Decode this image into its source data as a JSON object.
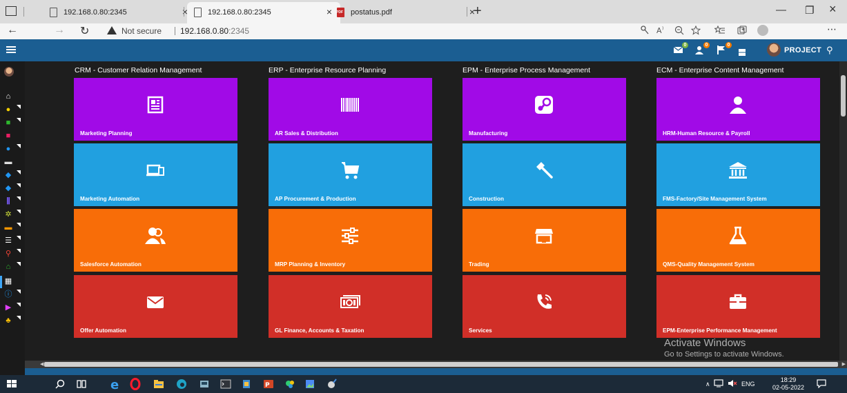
{
  "browser": {
    "tabs": [
      {
        "title": "192.168.0.80:2345",
        "active": false,
        "type": "page"
      },
      {
        "title": "192.168.0.80:2345",
        "active": true,
        "type": "page"
      },
      {
        "title": "postatus.pdf",
        "active": false,
        "type": "pdf"
      }
    ],
    "new_tab_label": "+",
    "close_glyph": "×",
    "security_label": "Not secure",
    "url_host": "192.168.0.80",
    "url_port": ":2345",
    "window_controls": {
      "minimize": "—",
      "restore": "❐",
      "close": "×"
    }
  },
  "header": {
    "project_label": "PROJECT",
    "badges": [
      {
        "icon": "mail-icon",
        "count": "0",
        "color": "#7cb342"
      },
      {
        "icon": "user-alert-icon",
        "count": "0",
        "color": "#f57c00"
      },
      {
        "icon": "flag-icon",
        "count": "0",
        "color": "#f57c00"
      }
    ],
    "accent_color": "#1b5e92"
  },
  "columns": [
    {
      "heading": "CRM - Customer Relation Management",
      "tiles": [
        {
          "label": "Marketing Planning",
          "icon": "newspaper-icon",
          "color": "#a10ae7"
        },
        {
          "label": "Marketing Automation",
          "icon": "devices-icon",
          "color": "#21a0e0"
        },
        {
          "label": "Salesforce Automation",
          "icon": "users-icon",
          "color": "#f86d08"
        },
        {
          "label": "Offer Automation",
          "icon": "envelope-icon",
          "color": "#d12f28"
        }
      ]
    },
    {
      "heading": "ERP - Enterprise Resource Planning",
      "tiles": [
        {
          "label": "AR Sales & Distribution",
          "icon": "barcode-icon",
          "color": "#a10ae7"
        },
        {
          "label": "AP Procurement & Production",
          "icon": "cart-icon",
          "color": "#21a0e0"
        },
        {
          "label": "MRP Planning & Inventory",
          "icon": "sliders-icon",
          "color": "#f86d08"
        },
        {
          "label": "GL Finance, Accounts & Taxation",
          "icon": "money-icon",
          "color": "#d12f28"
        }
      ]
    },
    {
      "heading": "EPM - Enterprise Process Management",
      "tiles": [
        {
          "label": "Manufacturing",
          "icon": "steam-icon",
          "color": "#a10ae7"
        },
        {
          "label": "Construction",
          "icon": "hammer-icon",
          "color": "#21a0e0"
        },
        {
          "label": "Trading",
          "icon": "store-icon",
          "color": "#f86d08"
        },
        {
          "label": "Services",
          "icon": "phone-icon",
          "color": "#d12f28"
        }
      ]
    },
    {
      "heading": "ECM - Enterprise Content Management",
      "tiles": [
        {
          "label": "HRM-Human Resource & Payroll",
          "icon": "person-icon",
          "color": "#a10ae7"
        },
        {
          "label": "FMS-Factory/Site Management System",
          "icon": "bank-icon",
          "color": "#21a0e0"
        },
        {
          "label": "QMS-Quality Management System",
          "icon": "flask-icon",
          "color": "#f86d08"
        },
        {
          "label": "EPM-Enterprise Performance Management",
          "icon": "briefcase-icon",
          "color": "#d12f28"
        }
      ]
    }
  ],
  "watermark": {
    "line1": "Activate Windows",
    "line2": "Go to Settings to activate Windows."
  },
  "taskbar": {
    "language": "ENG",
    "time": "18:29",
    "date": "02-05-2022"
  }
}
